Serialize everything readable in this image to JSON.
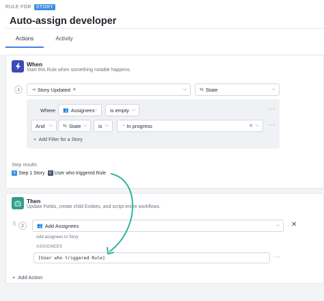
{
  "header": {
    "rule_for": "RULE FOR",
    "badge": "STORY",
    "title": "Auto-assign developer",
    "tabs": [
      "Actions",
      "Activity"
    ]
  },
  "when": {
    "title": "When",
    "description": "Start this Rule when something notable happens.",
    "step_number": "1",
    "trigger": "Story Updated",
    "trigger_field": "State",
    "filters": {
      "row1": {
        "prefix": "Where",
        "field": "Assignees",
        "operator": "is empty"
      },
      "row2": {
        "prefix": "And",
        "field": "State",
        "operator": "is",
        "value": "In progress"
      },
      "add_filter": "Add Filter for a Story"
    },
    "step_results": {
      "label": "Step results",
      "chips": [
        {
          "icon": "S",
          "label": "Step 1 Story"
        },
        {
          "icon": "U",
          "label": "User who triggered Rule"
        }
      ]
    }
  },
  "then": {
    "title": "Then",
    "description": "Update Fields, create child Entities, and script entire workflows.",
    "step_number": "2",
    "action": "Add Assignees",
    "action_desc": "Add assignees to Story",
    "field_label": "ASSIGNEES",
    "field_value": "[User who triggered Rule]",
    "add_action": "Add Action"
  },
  "colors": {
    "accent": "#4b7bec",
    "when_icon": "#3e4ab8",
    "then_icon": "#2f9f8a",
    "arrow": "#2fb59a",
    "badge": "#3f8fe0"
  }
}
